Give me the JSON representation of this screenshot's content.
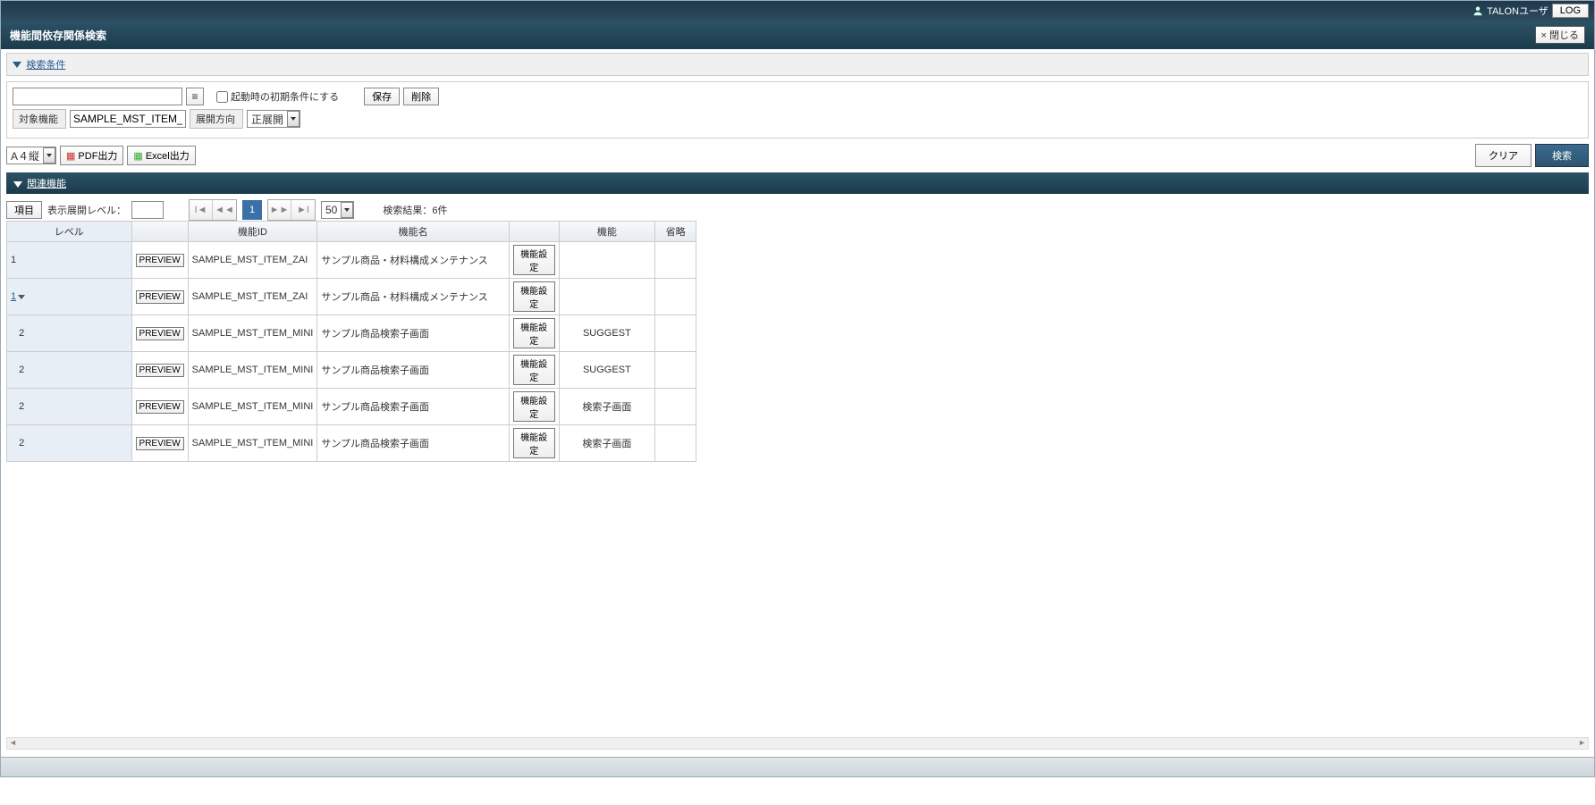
{
  "topbar": {
    "user": "TALONユーザ",
    "log_btn": "LOG"
  },
  "title": "機能間依存関係検索",
  "close_btn": "× 閉じる",
  "search_section": {
    "heading": "検索条件",
    "startup_chk": "起動時の初期条件にする",
    "save_btn": "保存",
    "delete_btn": "削除",
    "target_label": "対象機能",
    "target_value": "SAMPLE_MST_ITEM_ZAI",
    "direction_label": "展開方向",
    "direction_value": "正展開"
  },
  "export": {
    "paper": "A４縦",
    "pdf": "PDF出力",
    "excel": "Excel出力",
    "clear": "クリア",
    "search": "検索"
  },
  "result": {
    "heading": "関連機能",
    "item_btn": "項目",
    "expand_label": "表示展開レベル：",
    "page_size": "50",
    "count": "検索結果：6件",
    "headers": {
      "level": "レベル",
      "preview": "",
      "id": "機能ID",
      "name": "機能名",
      "settings": "",
      "func": "機能",
      "abbr": "省略"
    },
    "preview_btn": "PREVIEW",
    "settings_btn": "機能設定",
    "rows": [
      {
        "level": "1",
        "expandable": false,
        "id": "SAMPLE_MST_ITEM_ZAI",
        "name": "サンプル商品・材料構成メンテナンス",
        "func": "",
        "abbr": ""
      },
      {
        "level": "1",
        "expandable": true,
        "id": "SAMPLE_MST_ITEM_ZAI",
        "name": "サンプル商品・材料構成メンテナンス",
        "func": "",
        "abbr": ""
      },
      {
        "level": "2",
        "expandable": false,
        "id": "SAMPLE_MST_ITEM_MINI",
        "name": "サンプル商品検索子画面",
        "func": "SUGGEST",
        "abbr": ""
      },
      {
        "level": "2",
        "expandable": false,
        "id": "SAMPLE_MST_ITEM_MINI",
        "name": "サンプル商品検索子画面",
        "func": "SUGGEST",
        "abbr": ""
      },
      {
        "level": "2",
        "expandable": false,
        "id": "SAMPLE_MST_ITEM_MINI",
        "name": "サンプル商品検索子画面",
        "func": "検索子画面",
        "abbr": ""
      },
      {
        "level": "2",
        "expandable": false,
        "id": "SAMPLE_MST_ITEM_MINI",
        "name": "サンプル商品検索子画面",
        "func": "検索子画面",
        "abbr": ""
      }
    ]
  }
}
